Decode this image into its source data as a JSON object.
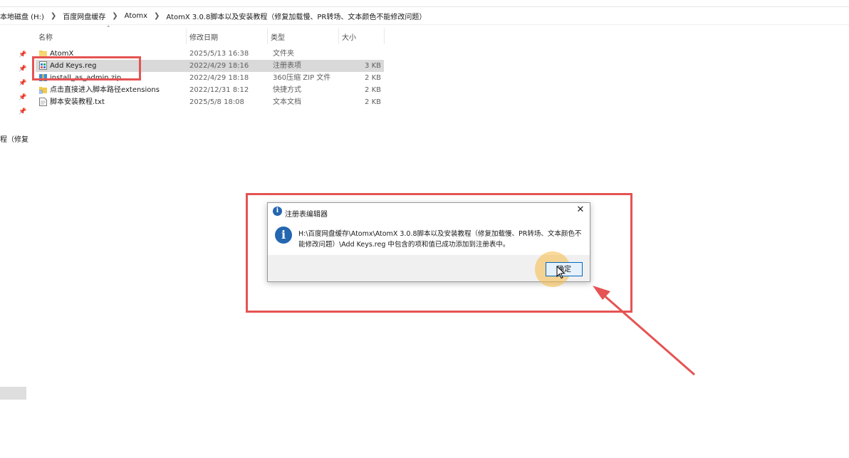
{
  "breadcrumb": [
    "本地磁盘 (H:)",
    "百度网盘缓存",
    "Atomx",
    "AtomX 3.0.8脚本以及安装教程（修复加载慢、PR转场、文本颜色不能修改问题）"
  ],
  "columns": {
    "name": "名称",
    "date": "修改日期",
    "type": "类型",
    "size": "大小"
  },
  "files": [
    {
      "name": "AtomX",
      "date": "2025/5/13 16:38",
      "type": "文件夹",
      "size": "",
      "icon": "folder-icon"
    },
    {
      "name": "Add Keys.reg",
      "date": "2022/4/29 18:16",
      "type": "注册表项",
      "size": "3 KB",
      "icon": "reg-file-icon",
      "selected": true
    },
    {
      "name": "install_as_admin.zip",
      "date": "2022/4/29 18:18",
      "type": "360压缩 ZIP 文件",
      "size": "2 KB",
      "icon": "zip-file-icon"
    },
    {
      "name": "点击直接进入脚本路径extensions",
      "date": "2022/12/31 8:12",
      "type": "快捷方式",
      "size": "2 KB",
      "icon": "shortcut-icon"
    },
    {
      "name": "脚本安装教程.txt",
      "date": "2025/5/8 18:08",
      "type": "文本文档",
      "size": "2 KB",
      "icon": "txt-file-icon"
    }
  ],
  "left_truncated": "程（修复",
  "dialog": {
    "title": "注册表编辑器",
    "message": "H:\\百度网盘缓存\\Atomx\\AtomX 3.0.8脚本以及安装教程（修复加载慢、PR转场、文本颜色不能修改问题）\\Add Keys.reg 中包含的项和值已成功添加到注册表中。",
    "ok_label": "确定"
  },
  "colors": {
    "highlight": "#e55353",
    "info_blue": "#2466b0",
    "selected_row": "#d9d9d9",
    "ok_border": "#0067c0",
    "click_halo": "#f6ba46"
  }
}
